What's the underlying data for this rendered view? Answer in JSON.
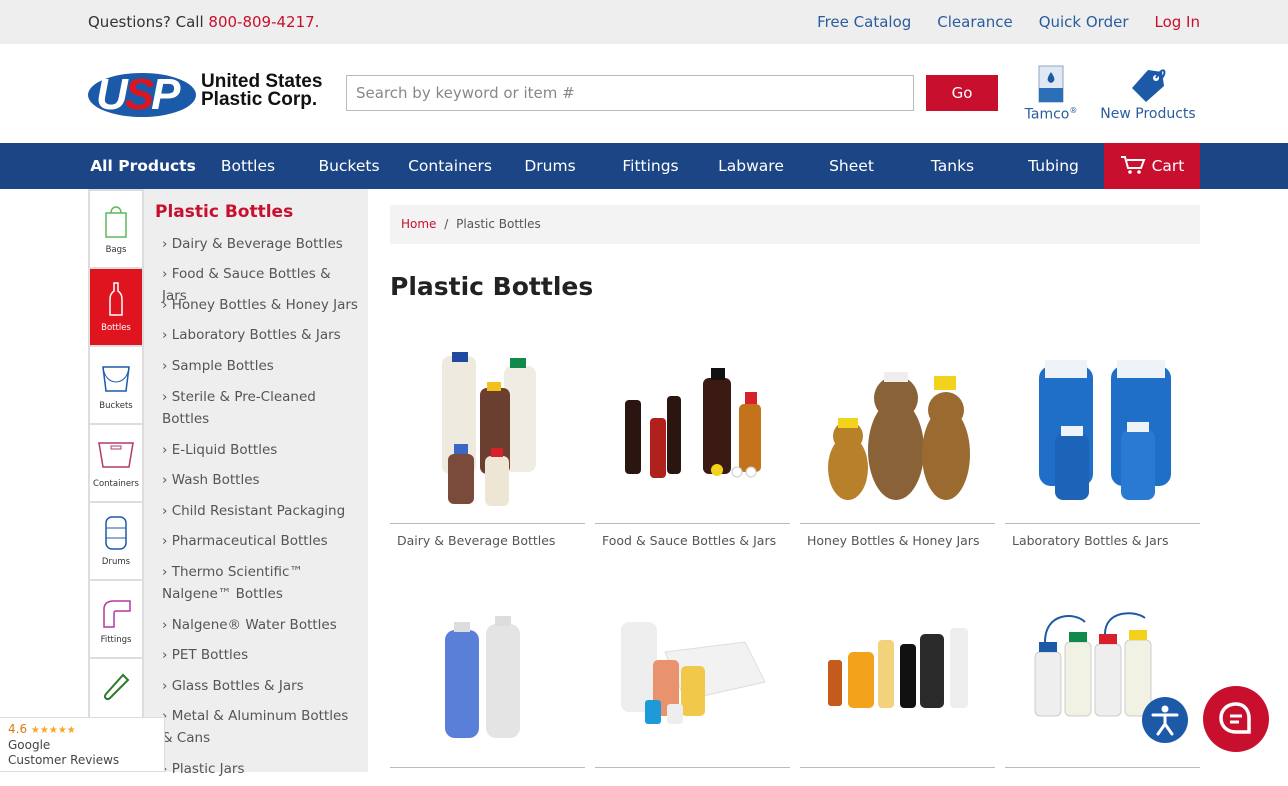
{
  "topbar": {
    "question": "Questions? Call ",
    "phone": "800-809-4217.",
    "links": [
      "Free Catalog",
      "Clearance",
      "Quick Order",
      "Log In"
    ]
  },
  "logo": {
    "letters_us": "U",
    "letters_s": "S",
    "letters_p": "P",
    "line1": "United States",
    "line2": "Plastic Corp."
  },
  "search": {
    "placeholder": "Search by keyword or item #",
    "button": "Go"
  },
  "header_icons": {
    "tamco": "Tamco",
    "tamco_reg": "®",
    "new_products": "New Products"
  },
  "nav": [
    "All Products",
    "Bottles",
    "Buckets",
    "Containers",
    "Drums",
    "Fittings",
    "Labware",
    "Sheet",
    "Tanks",
    "Tubing"
  ],
  "cart_label": "Cart",
  "category_strip": [
    "Bags",
    "Bottles",
    "Buckets",
    "Containers",
    "Drums",
    "Fittings"
  ],
  "sidemenu": {
    "title": "Plastic Bottles",
    "items": [
      "Dairy & Beverage Bottles",
      "Food & Sauce Bottles & Jars",
      "Honey Bottles & Honey Jars",
      "Laboratory Bottles & Jars",
      "Sample Bottles",
      "Sterile & Pre-Cleaned Bottles",
      "E-Liquid Bottles",
      "Wash Bottles",
      "Child Resistant Packaging",
      "Pharmaceutical Bottles",
      "Thermo Scientific™ Nalgene™ Bottles",
      "Nalgene® Water Bottles",
      "PET Bottles",
      "Glass Bottles & Jars",
      "Metal & Aluminum Bottles & Cans",
      "Plastic Jars"
    ]
  },
  "breadcrumb": {
    "home": "Home",
    "sep": "/",
    "current": "Plastic Bottles"
  },
  "page_title": "Plastic Bottles",
  "tiles": [
    "Dairy & Beverage Bottles",
    "Food & Sauce Bottles & Jars",
    "Honey Bottles & Honey Jars",
    "Laboratory Bottles & Jars",
    "",
    "",
    "",
    ""
  ],
  "google": {
    "score": "4.6",
    "stars": "★★★★★",
    "line1": "Google",
    "line2": "Customer Reviews"
  },
  "colors": {
    "brand_red": "#c8102e",
    "nav_blue": "#1c4585",
    "link_blue": "#2a5d9f"
  }
}
